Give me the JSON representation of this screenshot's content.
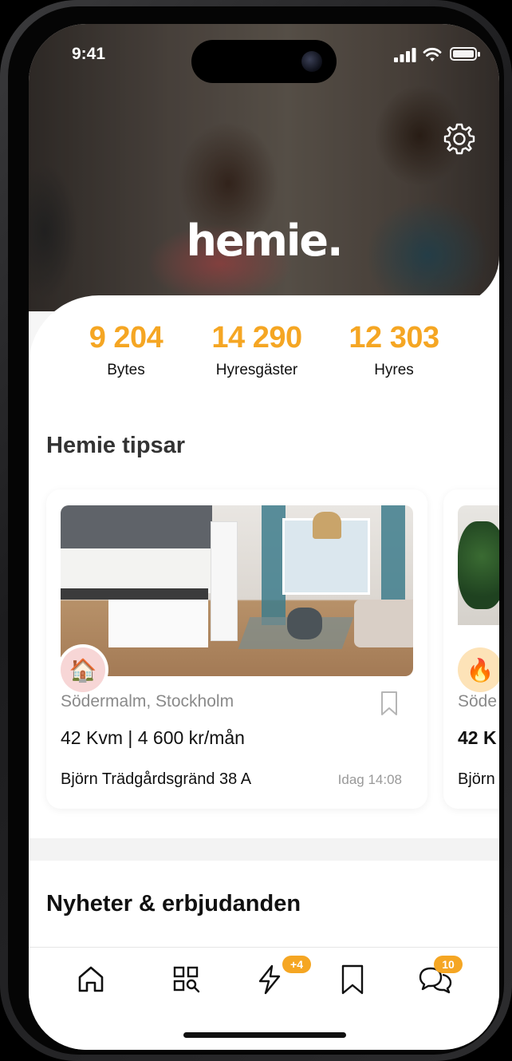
{
  "status_bar": {
    "time": "9:41"
  },
  "hero": {
    "logo": "hemie."
  },
  "stats": [
    {
      "value": "9 204",
      "label": "Bytes"
    },
    {
      "value": "14 290",
      "label": "Hyresgäster"
    },
    {
      "value": "12 303",
      "label": "Hyres"
    }
  ],
  "tips": {
    "title": "Hemie tipsar",
    "cards": [
      {
        "badge_icon": "house-emoji-icon",
        "badge_glyph": "🏠",
        "location": "Södermalm, Stockholm",
        "info": "42 Kvm | 4 600 kr/mån",
        "address": "Björn Trädgårdsgränd 38 A",
        "time": "Idag 14:08"
      },
      {
        "badge_icon": "fire-emoji-icon",
        "badge_glyph": "🔥",
        "location": "Söde",
        "info": "42 K",
        "address": "Björn"
      }
    ]
  },
  "news": {
    "title": "Nyheter & erbjudanden"
  },
  "tabbar": {
    "items": [
      {
        "icon": "home-icon"
      },
      {
        "icon": "search-grid-icon"
      },
      {
        "icon": "lightning-icon",
        "badge": "+4"
      },
      {
        "icon": "bookmark-icon"
      },
      {
        "icon": "chat-icon",
        "badge": "10"
      }
    ]
  },
  "colors": {
    "accent": "#f5a623",
    "text": "#111111",
    "muted": "#8a8a8a"
  }
}
